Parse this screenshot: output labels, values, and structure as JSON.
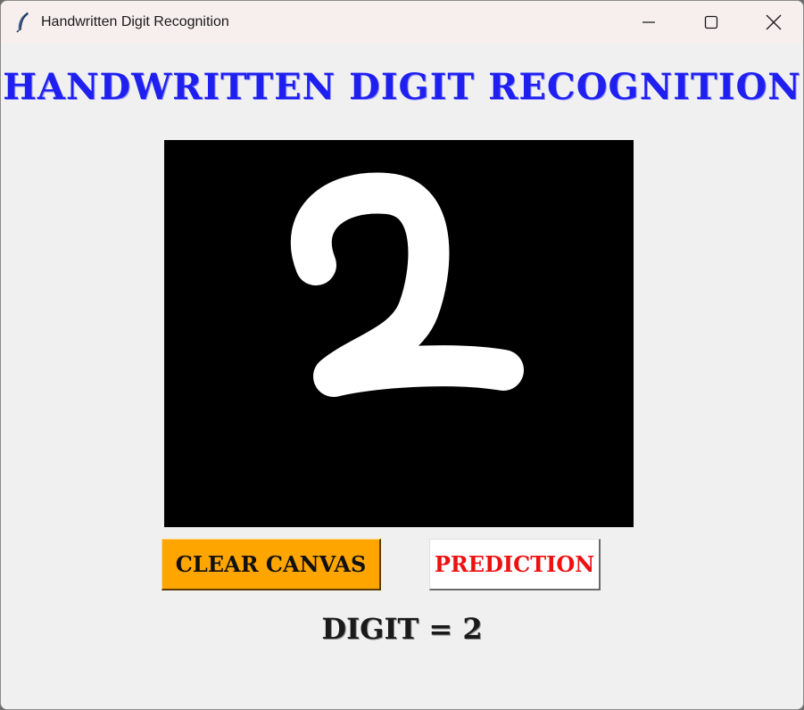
{
  "window": {
    "title": "Handwritten Digit Recognition",
    "icon": "feather-icon",
    "controls": {
      "minimize_icon": "minimize-icon",
      "maximize_icon": "maximize-icon",
      "close_icon": "close-icon"
    }
  },
  "app": {
    "heading": "HANDWRITTEN DIGIT RECOGNITION",
    "canvas": {
      "background_color": "#000000",
      "stroke_color": "#ffffff",
      "drawn_digit": "2"
    },
    "buttons": {
      "clear_label": "CLEAR CANVAS",
      "predict_label": "PREDICTION"
    },
    "result_text": "DIGIT = 2"
  },
  "colors": {
    "heading": "#1f20f0",
    "clear_button_bg": "#ffa500",
    "predict_button_text": "#ee1111",
    "window_bg": "#f0f0f0"
  }
}
